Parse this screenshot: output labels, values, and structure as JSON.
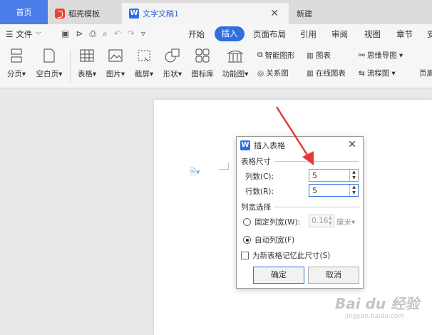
{
  "tabs": {
    "home": "首页",
    "daoke": "稻壳模板",
    "document": "文字文稿1",
    "new": "新建"
  },
  "menubar": {
    "file": "文件",
    "items": [
      "开始",
      "插入",
      "页面布局",
      "引用",
      "审阅",
      "视图",
      "章节",
      "安"
    ],
    "active": "插入"
  },
  "ribbon": {
    "page_break": "分页",
    "blank_page": "空白页",
    "table": "表格",
    "picture": "图片",
    "screenshot": "截屏",
    "shape": "形状",
    "icon_library": "图标库",
    "function_chart": "功能图",
    "smart_graphic": "智能图形",
    "chart": "图表",
    "mind_map": "思维导图",
    "relation": "关系图",
    "online_chart": "在线图表",
    "flowchart": "流程图",
    "page_header": "页眉"
  },
  "dialog": {
    "title": "插入表格",
    "size_section": "表格尺寸",
    "cols_label": "列数(C):",
    "cols_value": "5",
    "rows_label": "行数(R):",
    "rows_value": "5",
    "width_section": "列宽选择",
    "fixed_width_label": "固定列宽(W):",
    "fixed_width_value": "0.16",
    "unit": "厘米",
    "auto_width_label": "自动列宽(F)",
    "remember_label": "为新表格记忆此尺寸(S)",
    "ok": "确定",
    "cancel": "取消"
  },
  "watermark": {
    "main": "Bai du 经验",
    "sub": "jingyan.baidu.com"
  },
  "colors": {
    "accent": "#2f6fe0",
    "arrow": "#e53935"
  }
}
